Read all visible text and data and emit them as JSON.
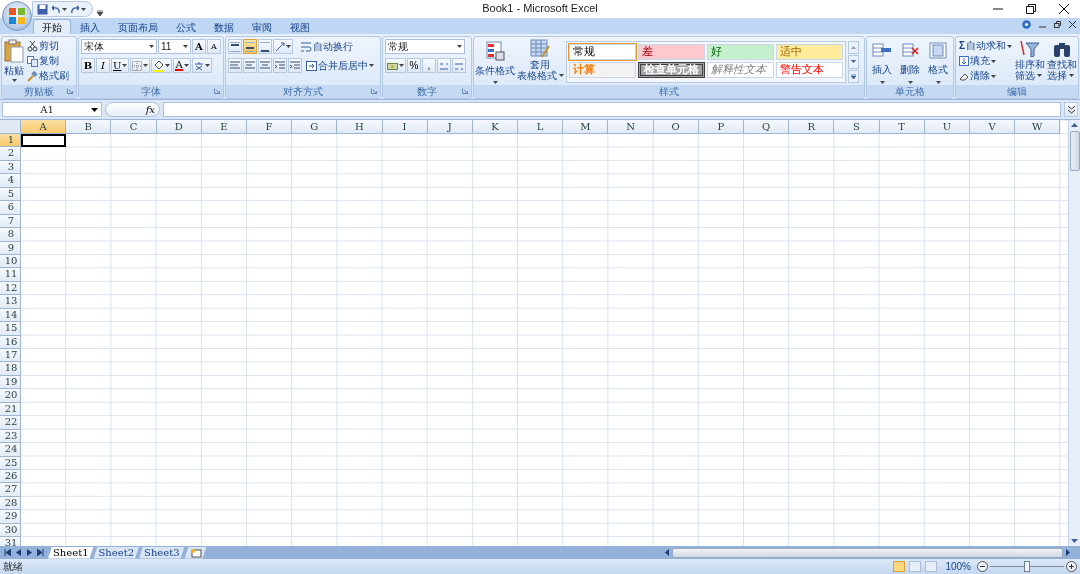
{
  "window": {
    "title": "Book1 - Microsoft Excel"
  },
  "tabs": [
    {
      "label": "开始",
      "selected": true
    },
    {
      "label": "插入",
      "selected": false
    },
    {
      "label": "页面布局",
      "selected": false
    },
    {
      "label": "公式",
      "selected": false
    },
    {
      "label": "数据",
      "selected": false
    },
    {
      "label": "审阅",
      "selected": false
    },
    {
      "label": "视图",
      "selected": false
    }
  ],
  "ribbon": {
    "clipboard": {
      "label": "剪贴板",
      "paste": "粘贴",
      "items": [
        "剪切",
        "复制",
        "格式刷"
      ]
    },
    "font": {
      "label": "字体",
      "font_name": "宋体",
      "font_size": "11",
      "grow": "A",
      "shrink": "A",
      "styles": [
        "B",
        "I",
        "U"
      ],
      "font_color_letter": "A"
    },
    "alignment": {
      "label": "对齐方式",
      "vertical": [
        {
          "selected": false
        },
        {
          "selected": true
        },
        {
          "selected": false
        }
      ],
      "wrap": "自动换行",
      "merge": "合并后居中"
    },
    "number": {
      "label": "数字",
      "format": "常规",
      "percent": "%",
      "comma": ","
    },
    "styles": {
      "label": "样式",
      "conditional": "条件格式",
      "table_format": [
        "套用",
        "表格格式"
      ],
      "gallery": [
        {
          "label": "常规",
          "kind": "normal",
          "selected": true
        },
        {
          "label": "差",
          "kind": "bad",
          "selected": false
        },
        {
          "label": "好",
          "kind": "good",
          "selected": false
        },
        {
          "label": "适中",
          "kind": "neutral",
          "selected": false
        },
        {
          "label": "计算",
          "kind": "calc",
          "selected": false
        },
        {
          "label": "检查单元格",
          "kind": "check",
          "selected": false
        },
        {
          "label": "解释性文本",
          "kind": "explanatory",
          "selected": false
        },
        {
          "label": "警告文本",
          "kind": "warning",
          "selected": false
        }
      ]
    },
    "cells": {
      "label": "单元格",
      "buttons": [
        "插入",
        "删除",
        "格式"
      ]
    },
    "editing": {
      "label": "编辑",
      "sigma": "Σ",
      "items": [
        "自动求和",
        "填充",
        "清除"
      ],
      "sort": [
        "排序和",
        "筛选"
      ],
      "find": [
        "查找和",
        "选择"
      ]
    }
  },
  "formula_bar": {
    "name_box": "A1",
    "fx": "fx"
  },
  "sheet": {
    "columns": [
      {
        "label": "A",
        "selected": true
      },
      {
        "label": "B",
        "selected": false
      },
      {
        "label": "C",
        "selected": false
      },
      {
        "label": "D",
        "selected": false
      },
      {
        "label": "E",
        "selected": false
      },
      {
        "label": "F",
        "selected": false
      },
      {
        "label": "G",
        "selected": false
      },
      {
        "label": "H",
        "selected": false
      },
      {
        "label": "I",
        "selected": false
      },
      {
        "label": "J",
        "selected": false
      },
      {
        "label": "K",
        "selected": false
      },
      {
        "label": "L",
        "selected": false
      },
      {
        "label": "M",
        "selected": false
      },
      {
        "label": "N",
        "selected": false
      },
      {
        "label": "O",
        "selected": false
      },
      {
        "label": "P",
        "selected": false
      },
      {
        "label": "Q",
        "selected": false
      },
      {
        "label": "R",
        "selected": false
      },
      {
        "label": "S",
        "selected": false
      },
      {
        "label": "T",
        "selected": false
      },
      {
        "label": "U",
        "selected": false
      },
      {
        "label": "V",
        "selected": false
      },
      {
        "label": "W",
        "selected": false
      }
    ],
    "rows": [
      {
        "label": "1",
        "selected": true
      },
      {
        "label": "2",
        "selected": false
      },
      {
        "label": "3",
        "selected": false
      },
      {
        "label": "4",
        "selected": false
      },
      {
        "label": "5",
        "selected": false
      },
      {
        "label": "6",
        "selected": false
      },
      {
        "label": "7",
        "selected": false
      },
      {
        "label": "8",
        "selected": false
      },
      {
        "label": "9",
        "selected": false
      },
      {
        "label": "10",
        "selected": false
      },
      {
        "label": "11",
        "selected": false
      },
      {
        "label": "12",
        "selected": false
      },
      {
        "label": "13",
        "selected": false
      },
      {
        "label": "14",
        "selected": false
      },
      {
        "label": "15",
        "selected": false
      },
      {
        "label": "16",
        "selected": false
      },
      {
        "label": "17",
        "selected": false
      },
      {
        "label": "18",
        "selected": false
      },
      {
        "label": "19",
        "selected": false
      },
      {
        "label": "20",
        "selected": false
      },
      {
        "label": "21",
        "selected": false
      },
      {
        "label": "22",
        "selected": false
      },
      {
        "label": "23",
        "selected": false
      },
      {
        "label": "24",
        "selected": false
      },
      {
        "label": "25",
        "selected": false
      },
      {
        "label": "26",
        "selected": false
      },
      {
        "label": "27",
        "selected": false
      },
      {
        "label": "28",
        "selected": false
      },
      {
        "label": "29",
        "selected": false
      },
      {
        "label": "30",
        "selected": false
      },
      {
        "label": "31",
        "selected": false
      }
    ]
  },
  "sheet_tabs": [
    {
      "label": "Sheet1",
      "selected": true
    },
    {
      "label": "Sheet2",
      "selected": false
    },
    {
      "label": "Sheet3",
      "selected": false
    }
  ],
  "status_bar": {
    "status": "就绪",
    "views": [
      {
        "selected": true
      },
      {
        "selected": false
      },
      {
        "selected": false
      }
    ],
    "zoom": "100%",
    "zoom_slider": {
      "level": 0.5
    }
  }
}
